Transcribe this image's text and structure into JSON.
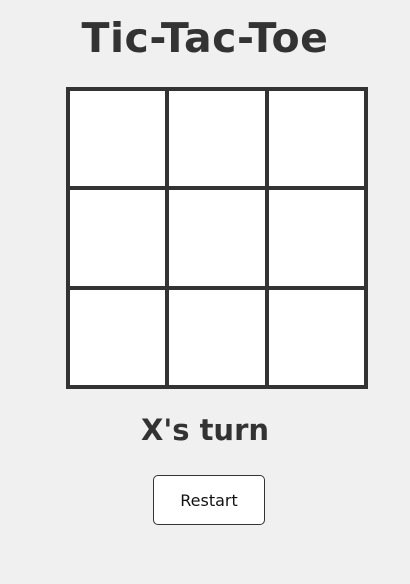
{
  "game": {
    "title": "Tic-Tac-Toe",
    "status": "X's turn",
    "restart_label": "Restart",
    "board": [
      "",
      "",
      "",
      "",
      "",
      "",
      "",
      "",
      ""
    ]
  },
  "colors": {
    "background": "#f0f0f0",
    "board_lines": "#333333",
    "cell": "#ffffff",
    "text": "#333333"
  }
}
